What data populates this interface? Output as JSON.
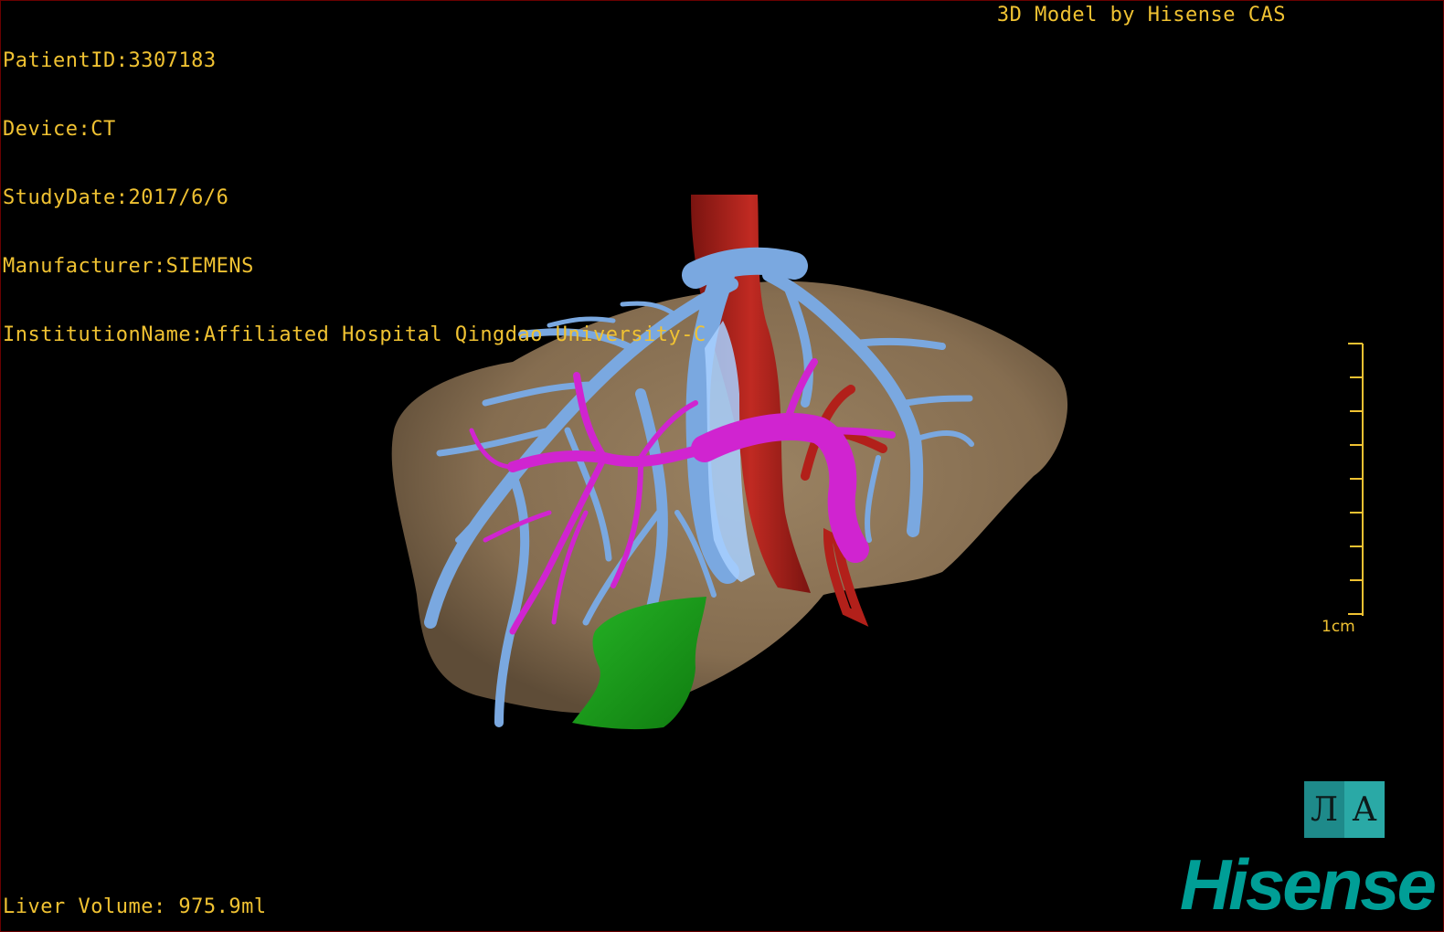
{
  "overlay": {
    "patient_id": "PatientID:3307183",
    "device": "Device:CT",
    "study_date": "StudyDate:2017/6/6",
    "manufacturer": "Manufacturer:SIEMENS",
    "institution": "InstitutionName:Affiliated Hospital Qingdao University-C",
    "credit": "3D Model by Hisense CAS",
    "liver_volume": "Liver Volume: 975.9ml"
  },
  "scale": {
    "label": "1cm"
  },
  "orientation": {
    "face_left": "Л",
    "face_right": "A"
  },
  "brand": {
    "logo_text": "Hisense"
  },
  "colors": {
    "text": "#f0c232",
    "liver": "#8a7356",
    "hepatic_vein": "#7aa8e0",
    "portal_vein": "#d024d0",
    "ivc_artery": "#b2201a",
    "gallbladder": "#1fa01f",
    "brand": "#009e96",
    "border": "#6a0000"
  }
}
